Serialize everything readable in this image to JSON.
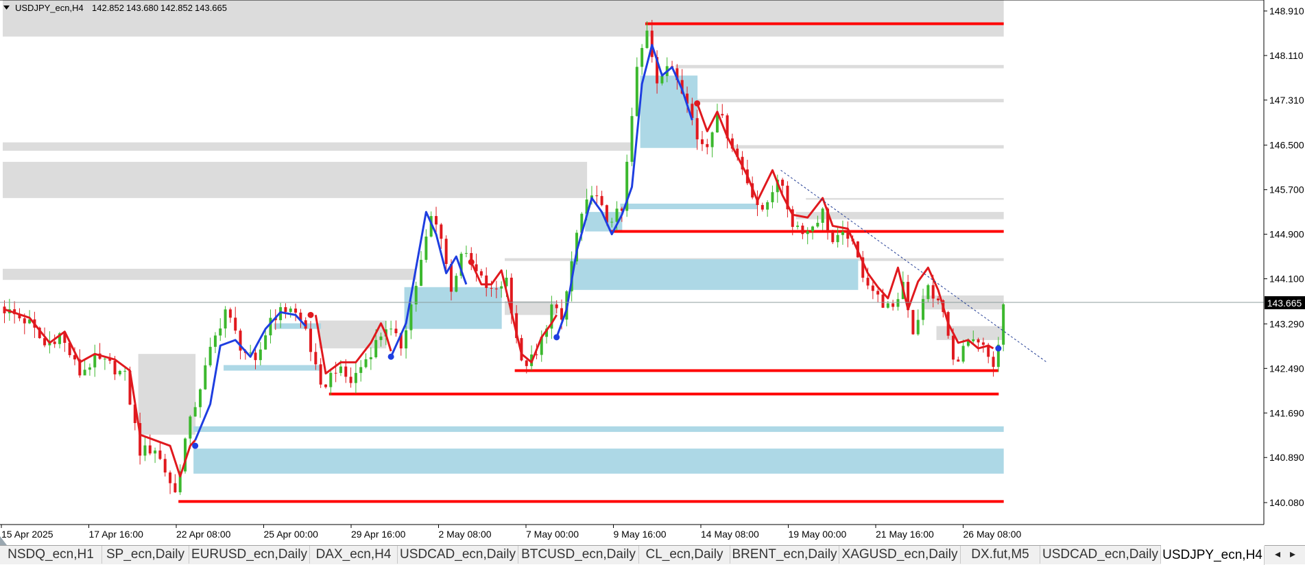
{
  "symbol_header": {
    "symbol": "USDJPY_ecn,H4",
    "ohlc": [
      "142.852",
      "143.680",
      "142.852",
      "143.665"
    ]
  },
  "chart_data": {
    "type": "candlestick",
    "title": "USDJPY_ecn,H4",
    "y_axis": {
      "ticks": [
        "148.910",
        "148.110",
        "147.310",
        "146.500",
        "145.700",
        "144.900",
        "144.100",
        "143.290",
        "142.490",
        "141.690",
        "140.890",
        "140.080"
      ],
      "range": [
        139.65,
        149.25
      ]
    },
    "x_axis": {
      "ticks": [
        "15 Apr 2025",
        "17 Apr 16:00",
        "22 Apr 08:00",
        "25 Apr 00:00",
        "29 Apr 16:00",
        "2 May 08:00",
        "7 May 00:00",
        "9 May 16:00",
        "14 May 08:00",
        "19 May 00:00",
        "21 May 16:00",
        "26 May 08:00"
      ]
    },
    "current_price": "143.665",
    "price_path": [
      {
        "bar": 0,
        "price": 143.55
      },
      {
        "bar": 5,
        "price": 143.3
      },
      {
        "bar": 8,
        "price": 142.9
      },
      {
        "bar": 11,
        "price": 143.1
      },
      {
        "bar": 15,
        "price": 142.4
      },
      {
        "bar": 18,
        "price": 142.65
      },
      {
        "bar": 21,
        "price": 142.55
      },
      {
        "bar": 24,
        "price": 142.35
      },
      {
        "bar": 27,
        "price": 141.0
      },
      {
        "bar": 30,
        "price": 141.05
      },
      {
        "bar": 34,
        "price": 140.25
      },
      {
        "bar": 36,
        "price": 141.2
      },
      {
        "bar": 38,
        "price": 141.85
      },
      {
        "bar": 41,
        "price": 142.8
      },
      {
        "bar": 44,
        "price": 143.55
      },
      {
        "bar": 47,
        "price": 142.9
      },
      {
        "bar": 50,
        "price": 142.55
      },
      {
        "bar": 53,
        "price": 143.4
      },
      {
        "bar": 57,
        "price": 143.6
      },
      {
        "bar": 60,
        "price": 143.2
      },
      {
        "bar": 63,
        "price": 142.1
      },
      {
        "bar": 66,
        "price": 142.5
      },
      {
        "bar": 69,
        "price": 142.25
      },
      {
        "bar": 73,
        "price": 142.8
      },
      {
        "bar": 76,
        "price": 143.25
      },
      {
        "bar": 79,
        "price": 142.9
      },
      {
        "bar": 82,
        "price": 144.0
      },
      {
        "bar": 85,
        "price": 145.2
      },
      {
        "bar": 87,
        "price": 144.9
      },
      {
        "bar": 89,
        "price": 143.85
      },
      {
        "bar": 91,
        "price": 144.6
      },
      {
        "bar": 94,
        "price": 144.2
      },
      {
        "bar": 97,
        "price": 143.85
      },
      {
        "bar": 100,
        "price": 144.1
      },
      {
        "bar": 103,
        "price": 142.55
      },
      {
        "bar": 106,
        "price": 142.7
      },
      {
        "bar": 109,
        "price": 143.6
      },
      {
        "bar": 111,
        "price": 143.35
      },
      {
        "bar": 114,
        "price": 144.9
      },
      {
        "bar": 117,
        "price": 145.7
      },
      {
        "bar": 120,
        "price": 145.15
      },
      {
        "bar": 123,
        "price": 145.3
      },
      {
        "bar": 126,
        "price": 147.85
      },
      {
        "bar": 128,
        "price": 148.6
      },
      {
        "bar": 130,
        "price": 147.7
      },
      {
        "bar": 133,
        "price": 147.9
      },
      {
        "bar": 136,
        "price": 147.35
      },
      {
        "bar": 138,
        "price": 146.6
      },
      {
        "bar": 140,
        "price": 146.5
      },
      {
        "bar": 142,
        "price": 147.15
      },
      {
        "bar": 145,
        "price": 146.5
      },
      {
        "bar": 148,
        "price": 145.85
      },
      {
        "bar": 151,
        "price": 145.25
      },
      {
        "bar": 154,
        "price": 145.95
      },
      {
        "bar": 157,
        "price": 145.1
      },
      {
        "bar": 160,
        "price": 144.95
      },
      {
        "bar": 163,
        "price": 145.3
      },
      {
        "bar": 165,
        "price": 144.75
      },
      {
        "bar": 168,
        "price": 144.9
      },
      {
        "bar": 171,
        "price": 144.2
      },
      {
        "bar": 174,
        "price": 143.75
      },
      {
        "bar": 177,
        "price": 143.5
      },
      {
        "bar": 179,
        "price": 144.05
      },
      {
        "bar": 181,
        "price": 143.15
      },
      {
        "bar": 184,
        "price": 143.95
      },
      {
        "bar": 187,
        "price": 143.5
      },
      {
        "bar": 189,
        "price": 142.6
      },
      {
        "bar": 192,
        "price": 142.95
      },
      {
        "bar": 195,
        "price": 142.85
      },
      {
        "bar": 197,
        "price": 142.45
      },
      {
        "bar": 198,
        "price": 142.9
      },
      {
        "bar": 199,
        "price": 143.665
      }
    ],
    "bar_count": 200,
    "supertrend": [
      {
        "color": "#e0191e",
        "points": [
          {
            "bar": 0,
            "price": 143.55
          },
          {
            "bar": 5,
            "price": 143.4
          },
          {
            "bar": 9,
            "price": 142.95
          },
          {
            "bar": 12,
            "price": 143.15
          },
          {
            "bar": 15,
            "price": 142.6
          },
          {
            "bar": 18,
            "price": 142.75
          },
          {
            "bar": 22,
            "price": 142.65
          },
          {
            "bar": 25,
            "price": 142.45
          },
          {
            "bar": 27,
            "price": 141.3
          },
          {
            "bar": 30,
            "price": 141.2
          },
          {
            "bar": 33,
            "price": 141.1
          },
          {
            "bar": 35,
            "price": 140.55
          },
          {
            "bar": 37,
            "price": 141.1
          },
          {
            "bar": 38,
            "price": 141.2
          }
        ]
      },
      {
        "color": "#1e3ee0",
        "points": [
          {
            "bar": 38,
            "price": 141.2
          },
          {
            "bar": 41,
            "price": 141.85
          },
          {
            "bar": 43,
            "price": 142.9
          },
          {
            "bar": 46,
            "price": 143.0
          },
          {
            "bar": 49,
            "price": 142.7
          },
          {
            "bar": 52,
            "price": 143.2
          },
          {
            "bar": 55,
            "price": 143.5
          },
          {
            "bar": 58,
            "price": 143.45
          },
          {
            "bar": 60,
            "price": 143.25
          }
        ]
      },
      {
        "color": "#e0191e",
        "points": [
          {
            "bar": 62,
            "price": 143.45
          },
          {
            "bar": 64,
            "price": 142.4
          },
          {
            "bar": 67,
            "price": 142.6
          },
          {
            "bar": 70,
            "price": 142.6
          },
          {
            "bar": 73,
            "price": 142.95
          },
          {
            "bar": 75,
            "price": 143.3
          },
          {
            "bar": 76,
            "price": 143.1
          },
          {
            "bar": 77,
            "price": 142.8
          }
        ]
      },
      {
        "color": "#1e3ee0",
        "points": [
          {
            "bar": 77,
            "price": 142.7
          },
          {
            "bar": 80,
            "price": 143.3
          },
          {
            "bar": 82,
            "price": 144.3
          },
          {
            "bar": 84,
            "price": 145.3
          },
          {
            "bar": 86,
            "price": 144.9
          },
          {
            "bar": 88,
            "price": 144.2
          },
          {
            "bar": 90,
            "price": 144.5
          },
          {
            "bar": 92,
            "price": 144.0
          }
        ]
      },
      {
        "color": "#e0191e",
        "points": [
          {
            "bar": 93,
            "price": 144.4
          },
          {
            "bar": 95,
            "price": 144.0
          },
          {
            "bar": 97,
            "price": 144.0
          },
          {
            "bar": 99,
            "price": 144.25
          },
          {
            "bar": 101,
            "price": 143.5
          },
          {
            "bar": 103,
            "price": 142.75
          },
          {
            "bar": 105,
            "price": 142.6
          },
          {
            "bar": 107,
            "price": 143.05
          },
          {
            "bar": 109,
            "price": 143.3
          },
          {
            "bar": 110,
            "price": 143.45
          }
        ]
      },
      {
        "color": "#1e3ee0",
        "points": [
          {
            "bar": 110,
            "price": 143.05
          },
          {
            "bar": 112,
            "price": 143.55
          },
          {
            "bar": 114,
            "price": 144.6
          },
          {
            "bar": 117,
            "price": 145.55
          },
          {
            "bar": 119,
            "price": 145.3
          },
          {
            "bar": 121,
            "price": 144.9
          },
          {
            "bar": 123,
            "price": 145.25
          },
          {
            "bar": 125,
            "price": 145.75
          },
          {
            "bar": 127,
            "price": 147.6
          },
          {
            "bar": 129,
            "price": 148.3
          },
          {
            "bar": 131,
            "price": 147.75
          },
          {
            "bar": 133,
            "price": 147.9
          },
          {
            "bar": 135,
            "price": 147.5
          },
          {
            "bar": 137,
            "price": 146.95
          }
        ]
      },
      {
        "color": "#e0191e",
        "points": [
          {
            "bar": 138,
            "price": 147.25
          },
          {
            "bar": 140,
            "price": 146.75
          },
          {
            "bar": 142,
            "price": 147.1
          },
          {
            "bar": 144,
            "price": 146.65
          },
          {
            "bar": 146,
            "price": 146.3
          },
          {
            "bar": 148,
            "price": 145.95
          },
          {
            "bar": 150,
            "price": 145.5
          },
          {
            "bar": 153,
            "price": 146.05
          },
          {
            "bar": 155,
            "price": 145.6
          },
          {
            "bar": 157,
            "price": 145.25
          },
          {
            "bar": 160,
            "price": 145.2
          },
          {
            "bar": 163,
            "price": 145.55
          },
          {
            "bar": 165,
            "price": 145.05
          },
          {
            "bar": 168,
            "price": 145.0
          },
          {
            "bar": 170,
            "price": 144.6
          },
          {
            "bar": 172,
            "price": 144.2
          },
          {
            "bar": 174,
            "price": 143.95
          },
          {
            "bar": 176,
            "price": 143.75
          },
          {
            "bar": 178,
            "price": 144.3
          },
          {
            "bar": 180,
            "price": 143.55
          },
          {
            "bar": 182,
            "price": 144.05
          },
          {
            "bar": 184,
            "price": 144.3
          },
          {
            "bar": 186,
            "price": 143.9
          },
          {
            "bar": 188,
            "price": 143.3
          },
          {
            "bar": 190,
            "price": 142.95
          },
          {
            "bar": 192,
            "price": 143.0
          },
          {
            "bar": 194,
            "price": 142.85
          },
          {
            "bar": 196,
            "price": 142.9
          },
          {
            "bar": 197,
            "price": 142.85
          }
        ]
      },
      {
        "color": "#1e3ee0",
        "points": [
          {
            "bar": 198,
            "price": 142.85
          }
        ]
      }
    ],
    "signal_dots": [
      {
        "bar": 38,
        "price": 141.1,
        "color": "#1e3ee0"
      },
      {
        "bar": 61,
        "price": 143.45,
        "color": "#e0191e"
      },
      {
        "bar": 77,
        "price": 142.7,
        "color": "#1e3ee0"
      },
      {
        "bar": 93,
        "price": 144.4,
        "color": "#e0191e"
      },
      {
        "bar": 110,
        "price": 143.05,
        "color": "#1e3ee0"
      },
      {
        "bar": 138,
        "price": 147.25,
        "color": "#e0191e"
      },
      {
        "bar": 198,
        "price": 142.85,
        "color": "#1e3ee0"
      }
    ],
    "supply_zones": [
      {
        "from_bar": 0,
        "to_bar": 199,
        "top": 149.25,
        "bottom": 148.45
      },
      {
        "from_bar": 0,
        "to_bar": 125,
        "top": 146.55,
        "bottom": 146.4
      },
      {
        "from_bar": 0,
        "to_bar": 116,
        "top": 146.2,
        "bottom": 145.55
      },
      {
        "from_bar": 0,
        "to_bar": 82,
        "top": 144.28,
        "bottom": 144.08
      },
      {
        "from_bar": 27,
        "to_bar": 38,
        "top": 142.75,
        "bottom": 141.3
      },
      {
        "from_bar": 63,
        "to_bar": 76,
        "top": 143.35,
        "bottom": 142.85
      },
      {
        "from_bar": 100,
        "to_bar": 110,
        "top": 143.7,
        "bottom": 143.45
      },
      {
        "from_bar": 134,
        "to_bar": 199,
        "top": 147.94,
        "bottom": 147.88
      },
      {
        "from_bar": 136,
        "to_bar": 199,
        "top": 147.33,
        "bottom": 147.27
      },
      {
        "from_bar": 145,
        "to_bar": 199,
        "top": 146.5,
        "bottom": 146.44
      },
      {
        "from_bar": 160,
        "to_bar": 199,
        "top": 145.55,
        "bottom": 145.52
      },
      {
        "from_bar": 158,
        "to_bar": 199,
        "top": 145.3,
        "bottom": 145.17
      },
      {
        "from_bar": 100,
        "to_bar": 199,
        "top": 144.47,
        "bottom": 144.42
      },
      {
        "from_bar": 183,
        "to_bar": 199,
        "top": 143.8,
        "bottom": 143.55
      },
      {
        "from_bar": 186,
        "to_bar": 199,
        "top": 143.25,
        "bottom": 143.0
      }
    ],
    "demand_zones": [
      {
        "from_bar": 38,
        "to_bar": 199,
        "top": 141.45,
        "bottom": 141.35
      },
      {
        "from_bar": 38,
        "to_bar": 199,
        "top": 141.05,
        "bottom": 140.6
      },
      {
        "from_bar": 44,
        "to_bar": 63,
        "top": 142.55,
        "bottom": 142.45
      },
      {
        "from_bar": 54,
        "to_bar": 63,
        "top": 143.3,
        "bottom": 143.2
      },
      {
        "from_bar": 80,
        "to_bar": 99,
        "top": 143.95,
        "bottom": 143.2
      },
      {
        "from_bar": 113,
        "to_bar": 170,
        "top": 144.45,
        "bottom": 143.9
      },
      {
        "from_bar": 116,
        "to_bar": 123,
        "top": 145.3,
        "bottom": 144.95
      },
      {
        "from_bar": 123,
        "to_bar": 150,
        "top": 145.45,
        "bottom": 145.35
      },
      {
        "from_bar": 127,
        "to_bar": 138,
        "top": 147.75,
        "bottom": 146.45
      }
    ],
    "level_lines": [
      {
        "from_bar": 128,
        "to_bar": 199,
        "price": 148.68
      },
      {
        "from_bar": 121,
        "to_bar": 199,
        "price": 144.95
      },
      {
        "from_bar": 102,
        "to_bar": 198,
        "price": 142.45
      },
      {
        "from_bar": 65,
        "to_bar": 198,
        "price": 142.03
      },
      {
        "from_bar": 35,
        "to_bar": 199,
        "price": 140.1
      }
    ],
    "trendline": {
      "from_bar": 155,
      "from_price": 146.05,
      "to_bar": 208,
      "to_price": 142.6
    },
    "grid": false,
    "legend": "none"
  },
  "tabs": [
    {
      "label": "NSDQ_ecn,H1"
    },
    {
      "label": "SP_ecn,Daily"
    },
    {
      "label": "EURUSD_ecn,Daily"
    },
    {
      "label": "DAX_ecn,H4"
    },
    {
      "label": "USDCAD_ecn,Daily"
    },
    {
      "label": "BTCUSD_ecn,Daily"
    },
    {
      "label": "CL_ecn,Daily"
    },
    {
      "label": "BRENT_ecn,Daily"
    },
    {
      "label": "XAGUSD_ecn,Daily"
    },
    {
      "label": "DX.fut,M5"
    },
    {
      "label": "USDCAD_ecn,Daily"
    },
    {
      "label": "USDJPY_ecn,H4",
      "active": true
    }
  ],
  "tab_scroll": {
    "left": "◂",
    "right": "▸"
  },
  "colors": {
    "bull": "#3cb82e",
    "bear": "#e0191e",
    "supertrend_up": "#1e3ee0",
    "supertrend_down": "#e0191e",
    "supply_zone": "#dcdcdc",
    "demand_zone": "#add8e6",
    "level_line": "#ff0000",
    "trendline": "#1f3a93",
    "price_label_bg": "#000000"
  }
}
